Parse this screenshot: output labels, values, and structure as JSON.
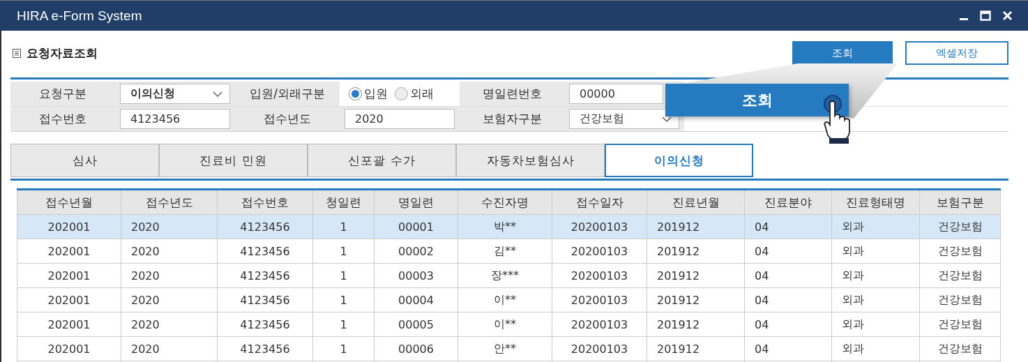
{
  "window": {
    "title": "HIRA e-Form System"
  },
  "page_title": "요청자료조회",
  "buttons": [
    {
      "label": "조회",
      "kind": "primary"
    },
    {
      "label": "엑셀저장",
      "kind": "outline"
    }
  ],
  "form": {
    "rows": [
      [
        {
          "kind": "select",
          "label": "요청구분",
          "value": "이의신청"
        },
        {
          "kind": "radio",
          "label": "입원/외래구분",
          "options": [
            {
              "label": "입원",
              "selected": true
            },
            {
              "label": "외래",
              "selected": false
            }
          ]
        },
        {
          "kind": "text",
          "label": "명일련번호",
          "value": "00000"
        }
      ],
      [
        {
          "kind": "text",
          "label": "접수번호",
          "value": "4123456"
        },
        {
          "kind": "text",
          "label": "접수년도",
          "value": "2020"
        },
        {
          "kind": "select",
          "label": "보험자구분",
          "value": "건강보험"
        }
      ]
    ]
  },
  "callout": {
    "label": "조회"
  },
  "tabs": [
    {
      "label": "심사",
      "selected": false
    },
    {
      "label": "진료비 민원",
      "selected": false
    },
    {
      "label": "신포괄 수가",
      "selected": false
    },
    {
      "label": "자동차보험심사",
      "selected": false
    },
    {
      "label": "이의신청",
      "selected": true
    }
  ],
  "table": {
    "columns": [
      "접수년월",
      "접수년도",
      "접수번호",
      "청일련",
      "명일련",
      "수진자명",
      "접수일자",
      "진료년월",
      "진료분야",
      "진료형태명",
      "보험구분"
    ],
    "rows": [
      {
        "selected": true,
        "cells": [
          "202001",
          "2020",
          "4123456",
          "1",
          "00001",
          "박**",
          "20200103",
          "201912",
          "04",
          "외과",
          "건강보험"
        ]
      },
      {
        "selected": false,
        "cells": [
          "202001",
          "2020",
          "4123456",
          "1",
          "00002",
          "김**",
          "20200103",
          "201912",
          "04",
          "외과",
          "건강보험"
        ]
      },
      {
        "selected": false,
        "cells": [
          "202001",
          "2020",
          "4123456",
          "1",
          "00003",
          "장***",
          "20200103",
          "201912",
          "04",
          "외과",
          "건강보험"
        ]
      },
      {
        "selected": false,
        "cells": [
          "202001",
          "2020",
          "4123456",
          "1",
          "00004",
          "이**",
          "20200103",
          "201912",
          "04",
          "외과",
          "건강보험"
        ]
      },
      {
        "selected": false,
        "cells": [
          "202001",
          "2020",
          "4123456",
          "1",
          "00005",
          "이**",
          "20200103",
          "201912",
          "04",
          "외과",
          "건강보험"
        ]
      },
      {
        "selected": false,
        "cells": [
          "202001",
          "2020",
          "4123456",
          "1",
          "00006",
          "안**",
          "20200103",
          "201912",
          "04",
          "외과",
          "건강보험"
        ]
      }
    ]
  }
}
